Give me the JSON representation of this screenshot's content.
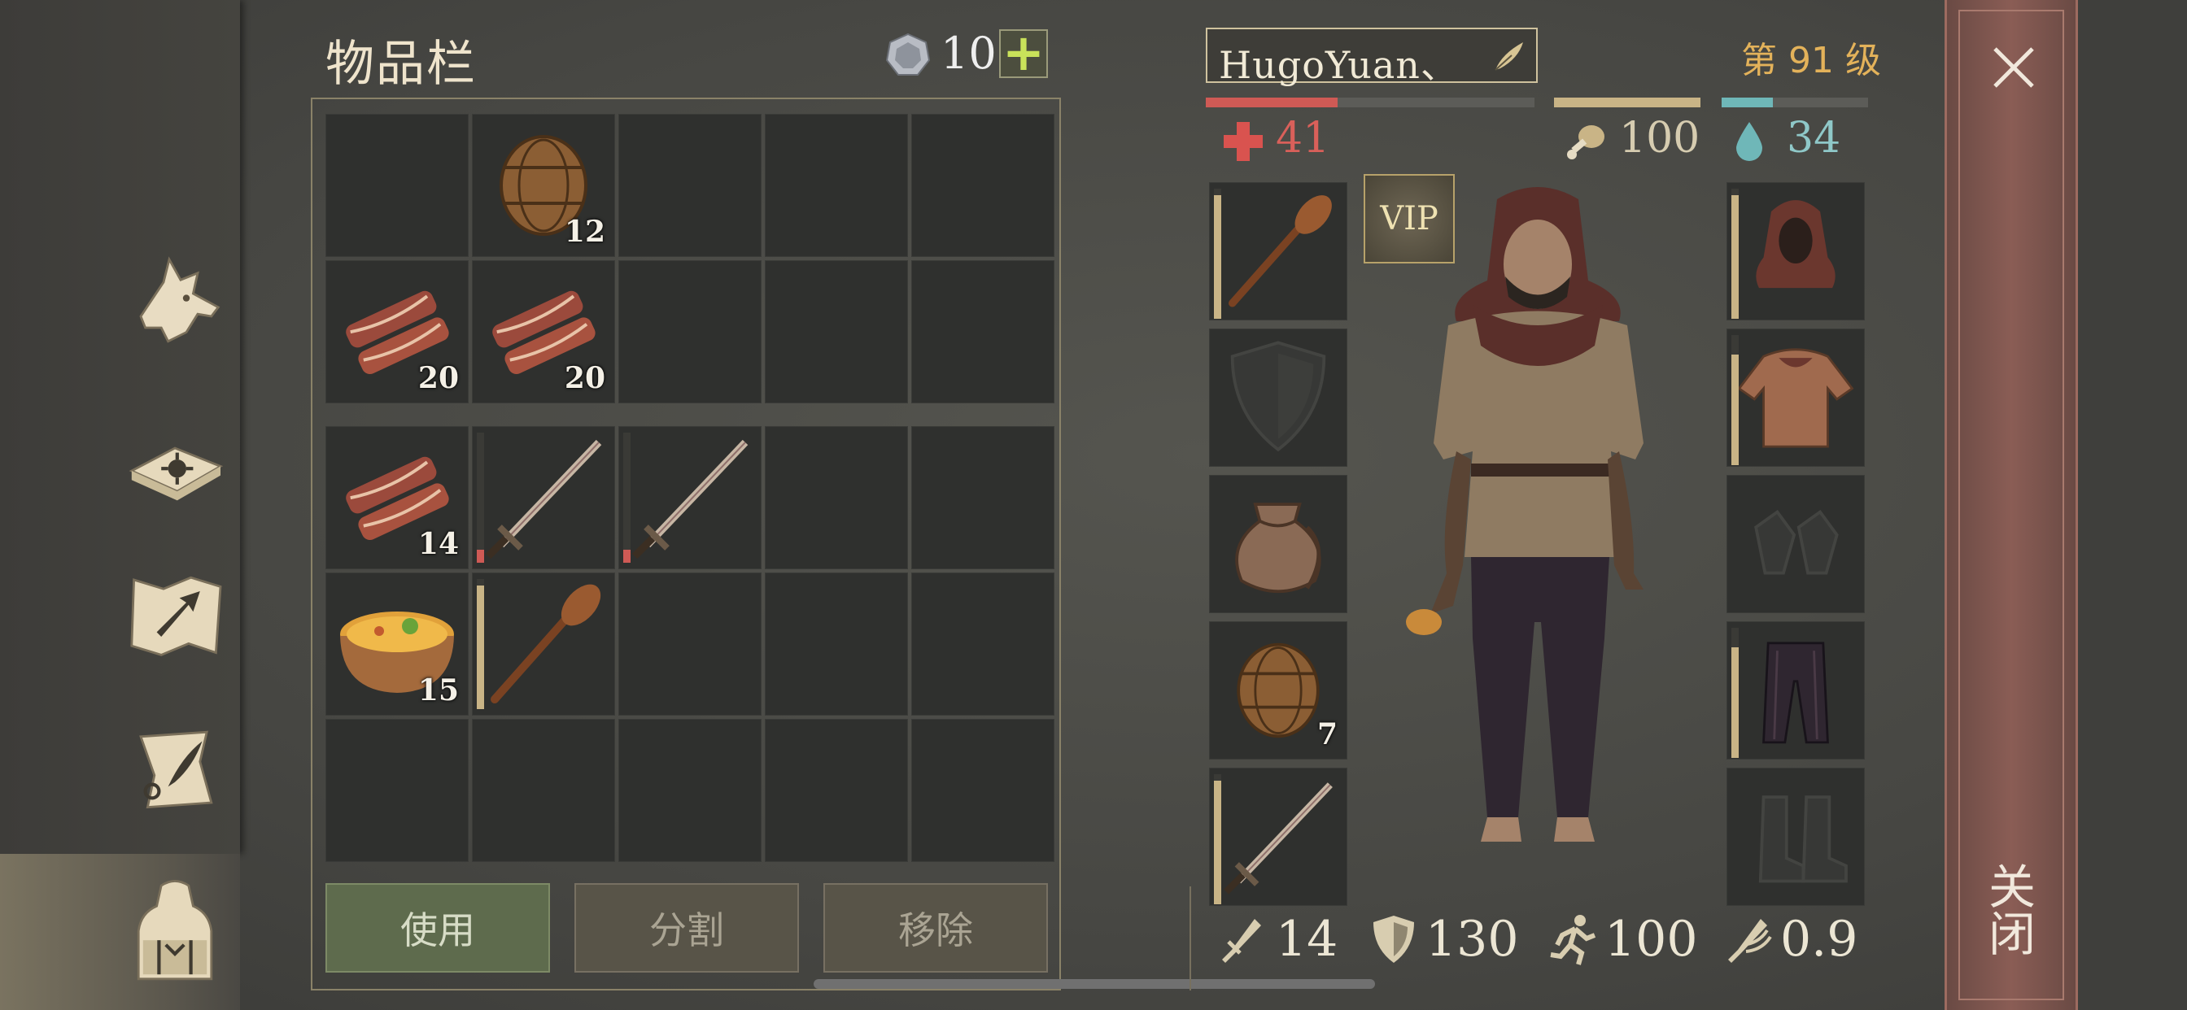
{
  "inventory": {
    "title": "物品栏",
    "coins": "10",
    "add_label": "+",
    "rows": [
      [
        {
          "item": "barrel-icon",
          "qty": "12"
        },
        {
          "item": ""
        },
        {
          "item": ""
        },
        {
          "item": ""
        },
        {
          "item": ""
        }
      ],
      [
        {
          "item": "meat-icon",
          "qty": "20"
        },
        {
          "item": "meat-icon",
          "qty": "20"
        },
        {
          "item": ""
        },
        {
          "item": ""
        },
        {
          "item": ""
        }
      ]
    ],
    "grid_first": [
      {
        "item": "",
        "qty": ""
      },
      {
        "item": "barrel-icon",
        "qty": "12"
      },
      {
        "item": "",
        "qty": ""
      },
      {
        "item": "",
        "qty": ""
      },
      {
        "item": "",
        "qty": ""
      },
      {
        "item": "meat-icon",
        "qty": "20"
      },
      {
        "item": "meat-icon",
        "qty": "20"
      },
      {
        "item": "",
        "qty": ""
      },
      {
        "item": "",
        "qty": ""
      },
      {
        "item": "",
        "qty": ""
      }
    ],
    "grid_second": [
      {
        "item": "meat-icon",
        "qty": "14"
      },
      {
        "item": "sword-icon",
        "qty": "",
        "durability": 0.1
      },
      {
        "item": "sword-icon",
        "qty": "",
        "durability": 0.1
      },
      {
        "item": "",
        "qty": ""
      },
      {
        "item": "",
        "qty": ""
      },
      {
        "item": "soup-bowl-icon",
        "qty": "15"
      },
      {
        "item": "club-icon",
        "qty": "",
        "durability": 0.95
      },
      {
        "item": "",
        "qty": ""
      },
      {
        "item": "",
        "qty": ""
      },
      {
        "item": "",
        "qty": ""
      },
      {
        "item": "",
        "qty": ""
      },
      {
        "item": "",
        "qty": ""
      },
      {
        "item": "",
        "qty": ""
      },
      {
        "item": "",
        "qty": ""
      },
      {
        "item": "",
        "qty": ""
      }
    ],
    "buttons": {
      "use": "使用",
      "split": "分割",
      "remove": "移除"
    }
  },
  "character": {
    "name": "HugoYuan、",
    "level": "第 91 级",
    "health": "41",
    "food": "100",
    "water": "34",
    "health_fraction": 0.4,
    "food_fraction": 1.0,
    "water_fraction": 0.35,
    "vip_label": "VIP",
    "left_slots": [
      {
        "item": "club-icon",
        "qty": "",
        "durability": 0.95
      },
      {
        "item": "shield-slot-icon",
        "qty": ""
      },
      {
        "item": "pouch-icon",
        "qty": ""
      },
      {
        "item": "barrel-icon",
        "qty": "7"
      },
      {
        "item": "sword-icon",
        "qty": "",
        "durability": 0.95
      }
    ],
    "right_slots": [
      {
        "item": "hood-icon",
        "durability": 0.95
      },
      {
        "item": "tunic-icon",
        "durability": 0.85
      },
      {
        "item": "gloves-slot-icon"
      },
      {
        "item": "pants-icon",
        "durability": 0.85
      },
      {
        "item": "boots-slot-icon"
      }
    ],
    "attack": "14",
    "defense": "130",
    "speed": "100",
    "attack_speed": "0.9"
  },
  "close_label": "关闭",
  "colors": {
    "health": "#cf5a55",
    "food": "#c9b486",
    "water": "#6fb7b8",
    "accent": "#e3b25a"
  }
}
